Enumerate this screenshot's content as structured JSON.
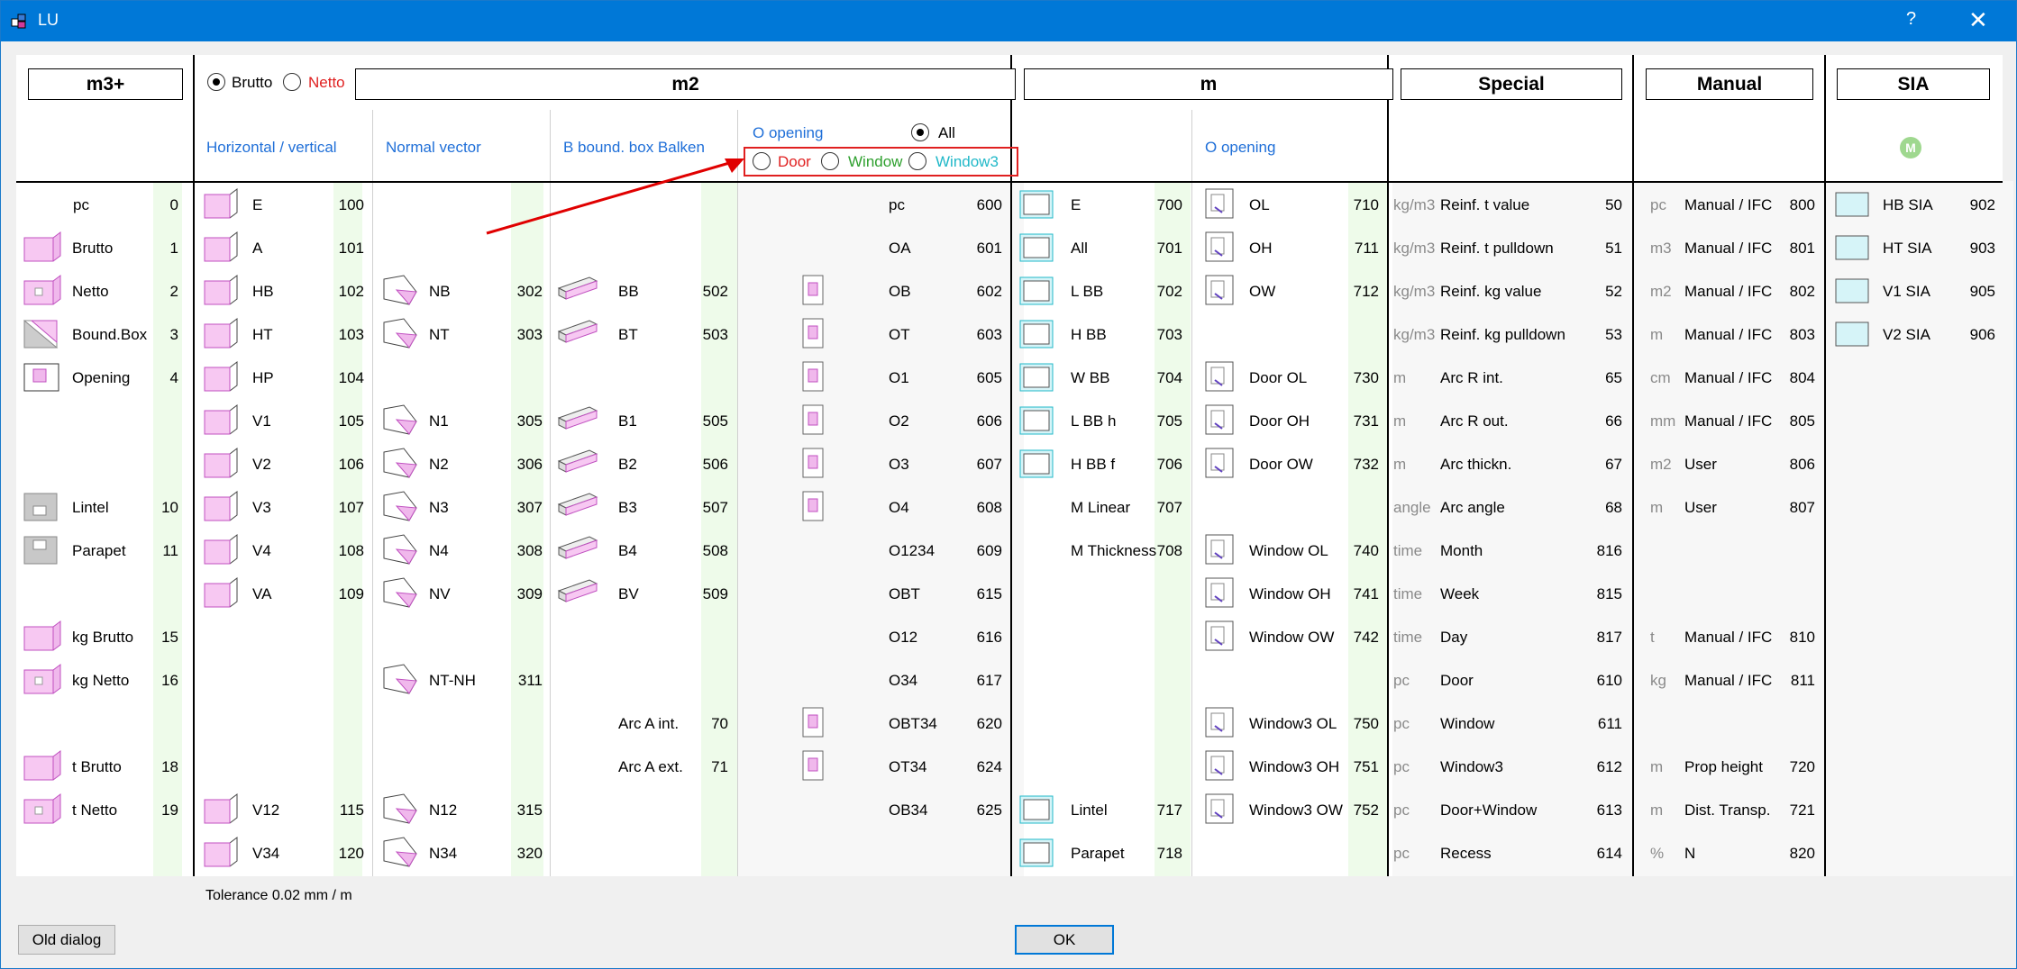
{
  "window": {
    "title": "LU",
    "help": "?",
    "close": "✕"
  },
  "headers": {
    "m3plus": "m3+",
    "m2": "m2",
    "m": "m",
    "special": "Special",
    "manual": "Manual",
    "sia": "SIA"
  },
  "radios": {
    "brutto": "Brutto",
    "netto": "Netto",
    "all": "All",
    "door": "Door",
    "window": "Window",
    "window3": "Window3"
  },
  "sub": {
    "hv": "Horizontal / vertical",
    "normal": "Normal vector",
    "bbox": "B bound. box Balken",
    "oopen": "O opening",
    "oopen2": "O opening",
    "m_icon": "M"
  },
  "colors": {
    "accent": "#0078d7",
    "netto_red": "#e02020",
    "door_red": "#e02020",
    "window_green": "#2ea02e",
    "window3_cyan": "#20b8c8",
    "link_blue": "#1f6fd8",
    "band": "#eefbea",
    "arrow": "#e00000"
  },
  "col1": [
    {
      "label": "pc",
      "num": "0",
      "icon": ""
    },
    {
      "label": "Brutto",
      "num": "1",
      "icon": "pink-block-icon"
    },
    {
      "label": "Netto",
      "num": "2",
      "icon": "pink-block-hole-icon"
    },
    {
      "label": "Bound.Box",
      "num": "3",
      "icon": "boundbox-icon"
    },
    {
      "label": "Opening",
      "num": "4",
      "icon": "opening-icon"
    },
    {
      "label": "",
      "num": "",
      "icon": ""
    },
    {
      "label": "",
      "num": "",
      "icon": ""
    },
    {
      "label": "Lintel",
      "num": "10",
      "icon": "lintel-icon"
    },
    {
      "label": "Parapet",
      "num": "11",
      "icon": "parapet-icon"
    },
    {
      "label": "",
      "num": "",
      "icon": ""
    },
    {
      "label": "kg Brutto",
      "num": "15",
      "icon": "pink-block-icon"
    },
    {
      "label": "kg Netto",
      "num": "16",
      "icon": "pink-block-hole-icon"
    },
    {
      "label": "",
      "num": "",
      "icon": ""
    },
    {
      "label": "t Brutto",
      "num": "18",
      "icon": "pink-block-icon"
    },
    {
      "label": "t Netto",
      "num": "19",
      "icon": "pink-block-hole-icon"
    },
    {
      "label": "",
      "num": "",
      "icon": ""
    }
  ],
  "col2": [
    {
      "label": "E",
      "num": "100"
    },
    {
      "label": "A",
      "num": "101"
    },
    {
      "label": "HB",
      "num": "102"
    },
    {
      "label": "HT",
      "num": "103"
    },
    {
      "label": "HP",
      "num": "104"
    },
    {
      "label": "V1",
      "num": "105"
    },
    {
      "label": "V2",
      "num": "106"
    },
    {
      "label": "V3",
      "num": "107"
    },
    {
      "label": "V4",
      "num": "108"
    },
    {
      "label": "VA",
      "num": "109"
    },
    {
      "label": "",
      "num": ""
    },
    {
      "label": "",
      "num": ""
    },
    {
      "label": "",
      "num": ""
    },
    {
      "label": "",
      "num": ""
    },
    {
      "label": "V12",
      "num": "115"
    },
    {
      "label": "V34",
      "num": "120"
    }
  ],
  "col3": [
    {
      "label": "",
      "num": ""
    },
    {
      "label": "",
      "num": ""
    },
    {
      "label": "NB",
      "num": "302"
    },
    {
      "label": "NT",
      "num": "303"
    },
    {
      "label": "",
      "num": ""
    },
    {
      "label": "N1",
      "num": "305"
    },
    {
      "label": "N2",
      "num": "306"
    },
    {
      "label": "N3",
      "num": "307"
    },
    {
      "label": "N4",
      "num": "308"
    },
    {
      "label": "NV",
      "num": "309"
    },
    {
      "label": "",
      "num": ""
    },
    {
      "label": "NT-NH",
      "num": "311"
    },
    {
      "label": "",
      "num": ""
    },
    {
      "label": "",
      "num": ""
    },
    {
      "label": "N12",
      "num": "315"
    },
    {
      "label": "N34",
      "num": "320"
    }
  ],
  "col4": [
    {
      "label": "",
      "num": ""
    },
    {
      "label": "",
      "num": ""
    },
    {
      "label": "BB",
      "num": "502"
    },
    {
      "label": "BT",
      "num": "503"
    },
    {
      "label": "",
      "num": ""
    },
    {
      "label": "B1",
      "num": "505"
    },
    {
      "label": "B2",
      "num": "506"
    },
    {
      "label": "B3",
      "num": "507"
    },
    {
      "label": "B4",
      "num": "508"
    },
    {
      "label": "BV",
      "num": "509"
    },
    {
      "label": "",
      "num": ""
    },
    {
      "label": "",
      "num": ""
    },
    {
      "label": "Arc A int.",
      "num": "70"
    },
    {
      "label": "Arc A ext.",
      "num": "71"
    },
    {
      "label": "",
      "num": ""
    },
    {
      "label": "",
      "num": ""
    }
  ],
  "col5": [
    {
      "label": "pc",
      "num": "600",
      "icon": false
    },
    {
      "label": "OA",
      "num": "601",
      "icon": false
    },
    {
      "label": "OB",
      "num": "602",
      "icon": true
    },
    {
      "label": "OT",
      "num": "603",
      "icon": true
    },
    {
      "label": "O1",
      "num": "605",
      "icon": true
    },
    {
      "label": "O2",
      "num": "606",
      "icon": true
    },
    {
      "label": "O3",
      "num": "607",
      "icon": true
    },
    {
      "label": "O4",
      "num": "608",
      "icon": true
    },
    {
      "label": "O1234",
      "num": "609",
      "icon": false
    },
    {
      "label": "OBT",
      "num": "615",
      "icon": false
    },
    {
      "label": "O12",
      "num": "616",
      "icon": false
    },
    {
      "label": "O34",
      "num": "617",
      "icon": false
    },
    {
      "label": "OBT34",
      "num": "620",
      "icon": true
    },
    {
      "label": "OT34",
      "num": "624",
      "icon": true
    },
    {
      "label": "OB34",
      "num": "625",
      "icon": false
    },
    {
      "label": "",
      "num": "",
      "icon": false
    }
  ],
  "col6": [
    {
      "label": "E",
      "num": "700"
    },
    {
      "label": "All",
      "num": "701"
    },
    {
      "label": "L BB",
      "num": "702"
    },
    {
      "label": "H BB",
      "num": "703"
    },
    {
      "label": "W BB",
      "num": "704"
    },
    {
      "label": "L BB h",
      "num": "705"
    },
    {
      "label": "H BB f",
      "num": "706"
    },
    {
      "label": "M Linear",
      "num": "707"
    },
    {
      "label": "M Thickness",
      "num": "708"
    },
    {
      "label": "",
      "num": ""
    },
    {
      "label": "",
      "num": ""
    },
    {
      "label": "",
      "num": ""
    },
    {
      "label": "",
      "num": ""
    },
    {
      "label": "",
      "num": ""
    },
    {
      "label": "Lintel",
      "num": "717"
    },
    {
      "label": "Parapet",
      "num": "718"
    }
  ],
  "col7": [
    {
      "label": "OL",
      "num": "710"
    },
    {
      "label": "OH",
      "num": "711"
    },
    {
      "label": "OW",
      "num": "712"
    },
    {
      "label": "",
      "num": ""
    },
    {
      "label": "Door OL",
      "num": "730"
    },
    {
      "label": "Door OH",
      "num": "731"
    },
    {
      "label": "Door OW",
      "num": "732"
    },
    {
      "label": "",
      "num": ""
    },
    {
      "label": "Window OL",
      "num": "740"
    },
    {
      "label": "Window OH",
      "num": "741"
    },
    {
      "label": "Window OW",
      "num": "742"
    },
    {
      "label": "",
      "num": ""
    },
    {
      "label": "Window3 OL",
      "num": "750"
    },
    {
      "label": "Window3 OH",
      "num": "751"
    },
    {
      "label": "Window3 OW",
      "num": "752"
    },
    {
      "label": "",
      "num": ""
    }
  ],
  "col8": [
    {
      "unit": "kg/m3",
      "label": "Reinf. t value",
      "num": "50"
    },
    {
      "unit": "kg/m3",
      "label": "Reinf. t pulldown",
      "num": "51"
    },
    {
      "unit": "kg/m3",
      "label": "Reinf. kg value",
      "num": "52"
    },
    {
      "unit": "kg/m3",
      "label": "Reinf. kg pulldown",
      "num": "53"
    },
    {
      "unit": "m",
      "label": "Arc R int.",
      "num": "65"
    },
    {
      "unit": "m",
      "label": "Arc R out.",
      "num": "66"
    },
    {
      "unit": "m",
      "label": "Arc thickn.",
      "num": "67"
    },
    {
      "unit": "angle",
      "label": "Arc angle",
      "num": "68"
    },
    {
      "unit": "time",
      "label": "Month",
      "num": "816"
    },
    {
      "unit": "time",
      "label": "Week",
      "num": "815"
    },
    {
      "unit": "time",
      "label": "Day",
      "num": "817"
    },
    {
      "unit": "pc",
      "label": "Door",
      "num": "610"
    },
    {
      "unit": "pc",
      "label": "Window",
      "num": "611"
    },
    {
      "unit": "pc",
      "label": "Window3",
      "num": "612"
    },
    {
      "unit": "pc",
      "label": "Door+Window",
      "num": "613"
    },
    {
      "unit": "pc",
      "label": "Recess",
      "num": "614"
    }
  ],
  "col9": [
    {
      "unit": "pc",
      "label": "Manual / IFC",
      "num": "800"
    },
    {
      "unit": "m3",
      "label": "Manual / IFC",
      "num": "801"
    },
    {
      "unit": "m2",
      "label": "Manual / IFC",
      "num": "802"
    },
    {
      "unit": "m",
      "label": "Manual / IFC",
      "num": "803"
    },
    {
      "unit": "cm",
      "label": "Manual / IFC",
      "num": "804"
    },
    {
      "unit": "mm",
      "label": "Manual / IFC",
      "num": "805"
    },
    {
      "unit": "m2",
      "label": "User",
      "num": "806"
    },
    {
      "unit": "m",
      "label": "User",
      "num": "807"
    },
    {
      "unit": "",
      "label": "",
      "num": ""
    },
    {
      "unit": "",
      "label": "",
      "num": ""
    },
    {
      "unit": "t",
      "label": "Manual / IFC",
      "num": "810"
    },
    {
      "unit": "kg",
      "label": "Manual / IFC",
      "num": "811"
    },
    {
      "unit": "",
      "label": "",
      "num": ""
    },
    {
      "unit": "m",
      "label": "Prop height",
      "num": "720"
    },
    {
      "unit": "m",
      "label": "Dist. Transp.",
      "num": "721"
    },
    {
      "unit": "%",
      "label": "N",
      "num": "820"
    }
  ],
  "col10": [
    {
      "label": "HB SIA",
      "num": "902"
    },
    {
      "label": "HT SIA",
      "num": "903"
    },
    {
      "label": "V1 SIA",
      "num": "905"
    },
    {
      "label": "V2 SIA",
      "num": "906"
    }
  ],
  "footer": {
    "tolerance": "Tolerance 0.02 mm / m",
    "old_dialog": "Old dialog",
    "ok": "OK"
  }
}
